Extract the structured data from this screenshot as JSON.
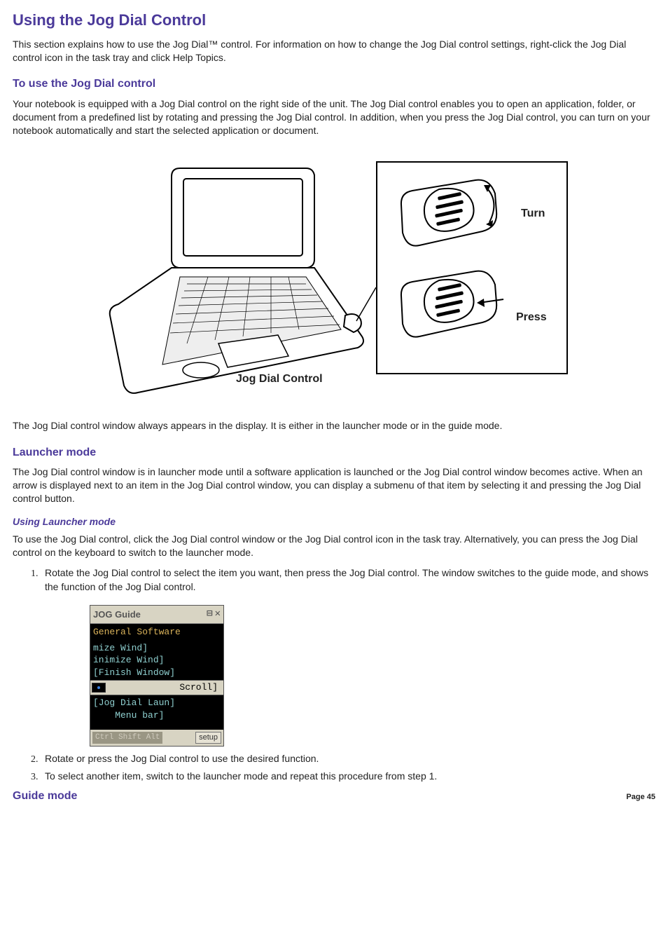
{
  "title": "Using the Jog Dial Control",
  "intro": "This section explains how to use the Jog Dial™ control. For information on how to change the Jog Dial control settings, right-click the Jog Dial control icon in the task tray and click Help Topics.",
  "section_use": {
    "heading": "To use the Jog Dial control",
    "para1": "Your notebook is equipped with a Jog Dial control on the right side of the unit. The Jog Dial control enables you to open an application, folder, or document from a predefined list by rotating and pressing the Jog Dial control. In addition, when you press the Jog Dial control, you can turn on your notebook automatically and start the selected application or document.",
    "fig_caption": "Jog Dial Control",
    "fig_turn": "Turn",
    "fig_press": "Press",
    "para2": "The Jog Dial control window always appears in the display. It is either in the launcher mode or in the guide mode."
  },
  "section_launcher": {
    "heading": "Launcher mode",
    "para1": "The Jog Dial control window is in launcher mode until a software application is launched or the Jog Dial control window becomes active. When an arrow is displayed next to an item in the Jog Dial control window, you can display a submenu of that item by selecting it and pressing the Jog Dial control button.",
    "sub_heading": "Using Launcher mode",
    "para2": "To use the Jog Dial control, click the Jog Dial control window or the Jog Dial control icon in the task tray. Alternatively, you can press the Jog Dial control on the keyboard to switch to the launcher mode.",
    "steps": [
      "Rotate the Jog Dial control to select the item you want, then press the Jog Dial control. The window switches to the guide mode, and shows the function of the Jog Dial control.",
      "Rotate or press the Jog Dial control to use the desired function.",
      "To select another item, switch to the launcher mode and repeat this procedure from step 1."
    ]
  },
  "jog_window": {
    "title": "JOG Guide",
    "header": "General Software",
    "rows": [
      "mize Wind]",
      "inimize Wind]",
      "[Finish Window]"
    ],
    "scroll_label": "Scroll]",
    "rows2": [
      "[Jog Dial Laun]",
      "    Menu bar]"
    ],
    "status_left": "Ctrl  Shift  Alt",
    "setup": "setup"
  },
  "section_guide_heading": "Guide mode",
  "page_label": "Page 45"
}
